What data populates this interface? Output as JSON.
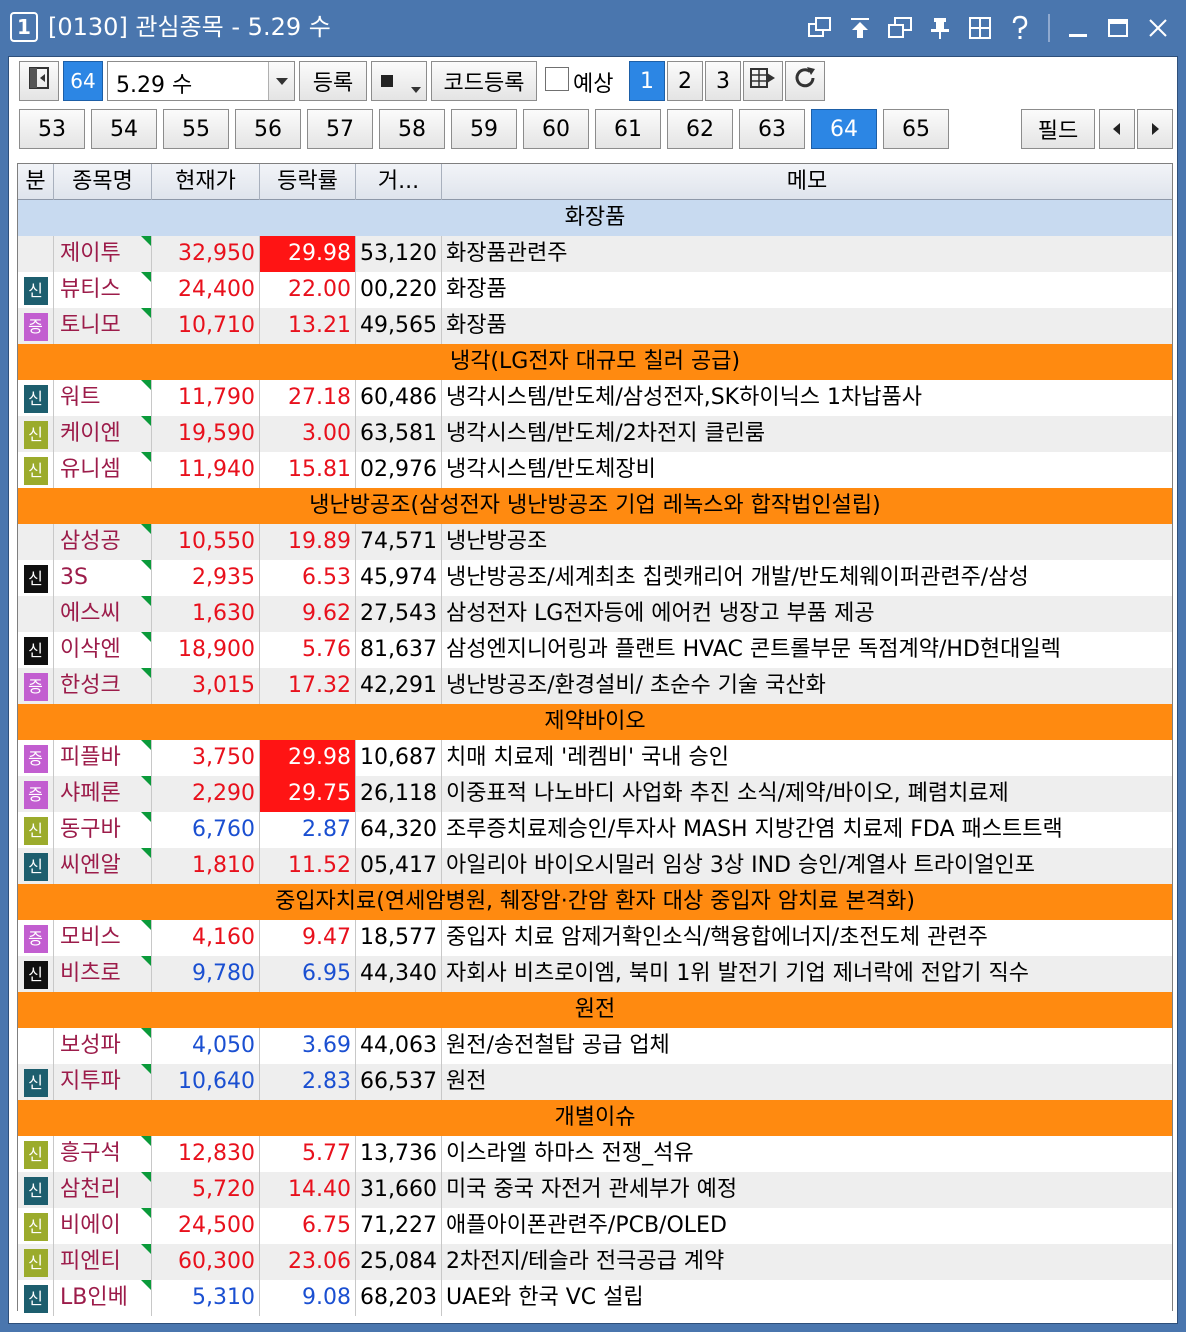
{
  "window": {
    "number": "1",
    "title": "[0130] 관심종목 - 5.29 수"
  },
  "toolbar": {
    "group_number": "64",
    "date_value": "5.29 수",
    "register_label": "등록",
    "code_register_label": "코드등록",
    "forecast_label": "예상",
    "pages": [
      "1",
      "2",
      "3"
    ],
    "active_page": "1"
  },
  "group_tabs": {
    "tabs": [
      "53",
      "54",
      "55",
      "56",
      "57",
      "58",
      "59",
      "60",
      "61",
      "62",
      "63",
      "64",
      "65"
    ],
    "active_tab": "64",
    "field_label": "필드"
  },
  "table": {
    "headers": {
      "div": "분",
      "name": "종목명",
      "price": "현재가",
      "rate": "등락률",
      "volume": "거...",
      "memo": "메모"
    },
    "rows": [
      {
        "kind": "group",
        "label": "화장품",
        "style": "blue"
      },
      {
        "kind": "stock",
        "badge": "",
        "badge_color": "",
        "name": "제이투",
        "price": "32,950",
        "price_dir": "up",
        "rate": "29.98",
        "rate_dir": "up",
        "rate_hl": true,
        "volume": "53,120",
        "memo": "화장품관련주"
      },
      {
        "kind": "stock",
        "badge": "신",
        "badge_color": "teal",
        "name": "뷰티스",
        "price": "24,400",
        "price_dir": "up",
        "rate": "22.00",
        "rate_dir": "up",
        "rate_hl": false,
        "volume": "00,220",
        "memo": "화장품"
      },
      {
        "kind": "stock",
        "badge": "증",
        "badge_color": "purple",
        "name": "토니모",
        "price": "10,710",
        "price_dir": "up",
        "rate": "13.21",
        "rate_dir": "up",
        "rate_hl": false,
        "volume": "49,565",
        "memo": "화장품"
      },
      {
        "kind": "group",
        "label": "냉각(LG전자 대규모 칠러 공급)",
        "style": "orange"
      },
      {
        "kind": "stock",
        "badge": "신",
        "badge_color": "teal",
        "name": "워트",
        "price": "11,790",
        "price_dir": "up",
        "rate": "27.18",
        "rate_dir": "up",
        "rate_hl": false,
        "volume": "60,486",
        "memo": "냉각시스템/반도체/삼성전자,SK하이닉스 1차납품사"
      },
      {
        "kind": "stock",
        "badge": "신",
        "badge_color": "olive",
        "name": "케이엔",
        "price": "19,590",
        "price_dir": "up",
        "rate": "3.00",
        "rate_dir": "up",
        "rate_hl": false,
        "volume": "63,581",
        "memo": "냉각시스템/반도체/2차전지 클린룸"
      },
      {
        "kind": "stock",
        "badge": "신",
        "badge_color": "olive",
        "name": "유니셈",
        "price": "11,940",
        "price_dir": "up",
        "rate": "15.81",
        "rate_dir": "up",
        "rate_hl": false,
        "volume": "02,976",
        "memo": "냉각시스템/반도체장비"
      },
      {
        "kind": "group",
        "label": "냉난방공조(삼성전자 냉난방공조 기업 레녹스와 합작법인설립)",
        "style": "orange"
      },
      {
        "kind": "stock",
        "badge": "",
        "badge_color": "",
        "name": "삼성공",
        "price": "10,550",
        "price_dir": "up",
        "rate": "19.89",
        "rate_dir": "up",
        "rate_hl": false,
        "volume": "74,571",
        "memo": "냉난방공조"
      },
      {
        "kind": "stock",
        "badge": "신",
        "badge_color": "black",
        "name": "3S",
        "price": "2,935",
        "price_dir": "up",
        "rate": "6.53",
        "rate_dir": "up",
        "rate_hl": false,
        "volume": "45,974",
        "memo": "냉난방공조/세계최초 칩렛캐리어 개발/반도체웨이퍼관련주/삼성"
      },
      {
        "kind": "stock",
        "badge": "",
        "badge_color": "",
        "name": "에스씨",
        "price": "1,630",
        "price_dir": "up",
        "rate": "9.62",
        "rate_dir": "up",
        "rate_hl": false,
        "volume": "27,543",
        "memo": "삼성전자 LG전자등에 에어컨 냉장고 부품 제공"
      },
      {
        "kind": "stock",
        "badge": "신",
        "badge_color": "black",
        "name": "이삭엔",
        "price": "18,900",
        "price_dir": "up",
        "rate": "5.76",
        "rate_dir": "up",
        "rate_hl": false,
        "volume": "81,637",
        "memo": "삼성엔지니어링과 플랜트 HVAC 콘트롤부문 독점계약/HD현대일렉"
      },
      {
        "kind": "stock",
        "badge": "증",
        "badge_color": "purple",
        "name": "한성크",
        "price": "3,015",
        "price_dir": "up",
        "rate": "17.32",
        "rate_dir": "up",
        "rate_hl": false,
        "volume": "42,291",
        "memo": "냉난방공조/환경설비/ 초순수 기술 국산화"
      },
      {
        "kind": "group",
        "label": "제약바이오",
        "style": "orange"
      },
      {
        "kind": "stock",
        "badge": "증",
        "badge_color": "purple",
        "name": "피플바",
        "price": "3,750",
        "price_dir": "up",
        "rate": "29.98",
        "rate_dir": "up",
        "rate_hl": true,
        "volume": "10,687",
        "memo": "치매 치료제 '레켐비' 국내 승인"
      },
      {
        "kind": "stock",
        "badge": "증",
        "badge_color": "purple",
        "name": "샤페론",
        "price": "2,290",
        "price_dir": "up",
        "rate": "29.75",
        "rate_dir": "up",
        "rate_hl": true,
        "volume": "26,118",
        "memo": "이중표적 나노바디 사업화 추진 소식/제약/바이오, 폐렴치료제"
      },
      {
        "kind": "stock",
        "badge": "신",
        "badge_color": "olive",
        "name": "동구바",
        "price": "6,760",
        "price_dir": "dn",
        "rate": "2.87",
        "rate_dir": "dn",
        "rate_hl": false,
        "volume": "64,320",
        "memo": "조루증치료제승인/투자사 MASH 지방간염 치료제 FDA 패스트트랙"
      },
      {
        "kind": "stock",
        "badge": "신",
        "badge_color": "teal",
        "name": "씨엔알",
        "price": "1,810",
        "price_dir": "up",
        "rate": "11.52",
        "rate_dir": "up",
        "rate_hl": false,
        "volume": "05,417",
        "memo": "아일리아 바이오시밀러 임상 3상 IND 승인/계열사 트라이얼인포"
      },
      {
        "kind": "group",
        "label": "중입자치료(연세암병원, 췌장암·간암 환자 대상 중입자 암치료 본격화)",
        "style": "orange"
      },
      {
        "kind": "stock",
        "badge": "증",
        "badge_color": "purple",
        "name": "모비스",
        "price": "4,160",
        "price_dir": "up",
        "rate": "9.47",
        "rate_dir": "up",
        "rate_hl": false,
        "volume": "18,577",
        "memo": "중입자 치료 암제거확인소식/핵융합에너지/초전도체 관련주"
      },
      {
        "kind": "stock",
        "badge": "신",
        "badge_color": "black",
        "name": "비츠로",
        "price": "9,780",
        "price_dir": "dn",
        "rate": "6.95",
        "rate_dir": "dn",
        "rate_hl": false,
        "volume": "44,340",
        "memo": "자회사 비츠로이엠, 북미 1위 발전기 기업 제너락에 전압기 직수"
      },
      {
        "kind": "group",
        "label": "원전",
        "style": "orange"
      },
      {
        "kind": "stock",
        "badge": "",
        "badge_color": "",
        "name": "보성파",
        "price": "4,050",
        "price_dir": "dn",
        "rate": "3.69",
        "rate_dir": "dn",
        "rate_hl": false,
        "volume": "44,063",
        "memo": "원전/송전철탑 공급 업체"
      },
      {
        "kind": "stock",
        "badge": "신",
        "badge_color": "teal",
        "name": "지투파",
        "price": "10,640",
        "price_dir": "dn",
        "rate": "2.83",
        "rate_dir": "dn",
        "rate_hl": false,
        "volume": "66,537",
        "memo": "원전"
      },
      {
        "kind": "group",
        "label": "개별이슈",
        "style": "orange"
      },
      {
        "kind": "stock",
        "badge": "신",
        "badge_color": "olive",
        "name": "흥구석",
        "price": "12,830",
        "price_dir": "up",
        "rate": "5.77",
        "rate_dir": "up",
        "rate_hl": false,
        "volume": "13,736",
        "memo": "이스라엘 하마스 전쟁_석유"
      },
      {
        "kind": "stock",
        "badge": "신",
        "badge_color": "teal",
        "name": "삼천리",
        "price": "5,720",
        "price_dir": "up",
        "rate": "14.40",
        "rate_dir": "up",
        "rate_hl": false,
        "volume": "31,660",
        "memo": "미국 중국 자전거 관세부가 예정"
      },
      {
        "kind": "stock",
        "badge": "신",
        "badge_color": "olive",
        "name": "비에이",
        "price": "24,500",
        "price_dir": "up",
        "rate": "6.75",
        "rate_dir": "up",
        "rate_hl": false,
        "volume": "71,227",
        "memo": "애플아이폰관련주/PCB/OLED"
      },
      {
        "kind": "stock",
        "badge": "신",
        "badge_color": "olive",
        "name": "피엔티",
        "price": "60,300",
        "price_dir": "up",
        "rate": "23.06",
        "rate_dir": "up",
        "rate_hl": false,
        "volume": "25,084",
        "memo": "2차전지/테슬라 전극공급 계약"
      },
      {
        "kind": "stock",
        "badge": "신",
        "badge_color": "teal",
        "name": "LB인베",
        "price": "5,310",
        "price_dir": "dn",
        "rate": "9.08",
        "rate_dir": "dn",
        "rate_hl": false,
        "volume": "68,203",
        "memo": "UAE와 한국 VC 설립"
      }
    ]
  },
  "colors": {
    "titlebar": "#4a76ae",
    "group_orange": "#ff8a10",
    "group_blue": "#c8daf0",
    "up": "#e8101c",
    "down": "#1a4fd1",
    "highlight": "#ff1414",
    "active_button": "#2c86e4"
  },
  "icons": [
    "link-window-icon",
    "pin-top-icon",
    "cascade-icon",
    "pushpin-icon",
    "grid-icon",
    "help-icon",
    "minimize-icon",
    "maximize-icon",
    "close-icon",
    "sidebar-toggle-icon",
    "stop-square-icon",
    "export-icon",
    "refresh-icon",
    "prev-arrow-icon",
    "next-arrow-icon"
  ]
}
